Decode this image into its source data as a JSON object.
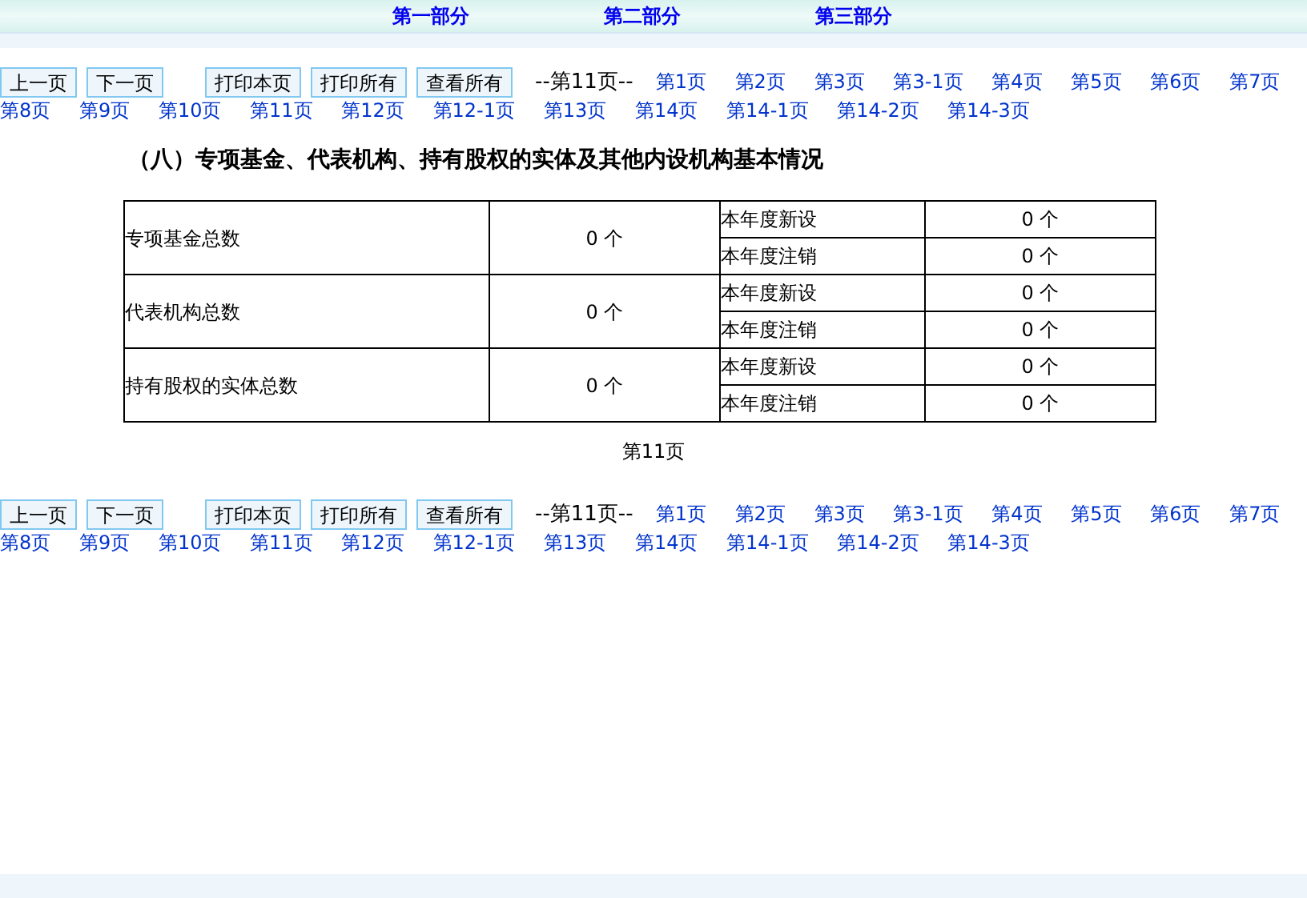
{
  "header_links": [
    "第一部分",
    "第二部分",
    "第三部分"
  ],
  "navs": [
    {
      "buttons": [
        "上一页",
        "下一页",
        "打印本页",
        "打印所有",
        "查看所有"
      ],
      "current": "--第11页--",
      "page_links": [
        "第1页",
        "第2页",
        "第3页",
        "第3-1页",
        "第4页",
        "第5页",
        "第6页",
        "第7页",
        "第8页",
        "第9页",
        "第10页",
        "第11页",
        "第12页",
        "第12-1页",
        "第13页",
        "第14页",
        "第14-1页",
        "第14-2页",
        "第14-3页"
      ]
    },
    {
      "buttons": [
        "上一页",
        "下一页",
        "打印本页",
        "打印所有",
        "查看所有"
      ],
      "current": "--第11页--",
      "page_links": [
        "第1页",
        "第2页",
        "第3页",
        "第3-1页",
        "第4页",
        "第5页",
        "第6页",
        "第7页",
        "第8页",
        "第9页",
        "第10页",
        "第11页",
        "第12页",
        "第12-1页",
        "第13页",
        "第14页",
        "第14-1页",
        "第14-2页",
        "第14-3页"
      ]
    }
  ],
  "heading": "（八）专项基金、代表机构、持有股权的实体及其他内设机构基本情况",
  "table": {
    "rows": [
      {
        "label": "专项基金总数",
        "total": "0 个",
        "sub": [
          {
            "label": "本年度新设",
            "value": "0 个"
          },
          {
            "label": "本年度注销",
            "value": "0 个"
          }
        ]
      },
      {
        "label": "代表机构总数",
        "total": "0 个",
        "sub": [
          {
            "label": "本年度新设",
            "value": "0 个"
          },
          {
            "label": "本年度注销",
            "value": "0 个"
          }
        ]
      },
      {
        "label": "持有股权的实体总数",
        "total": "0 个",
        "sub": [
          {
            "label": "本年度新设",
            "value": "0 个"
          },
          {
            "label": "本年度注销",
            "value": "0 个"
          }
        ]
      }
    ]
  },
  "page_label": "第11页"
}
